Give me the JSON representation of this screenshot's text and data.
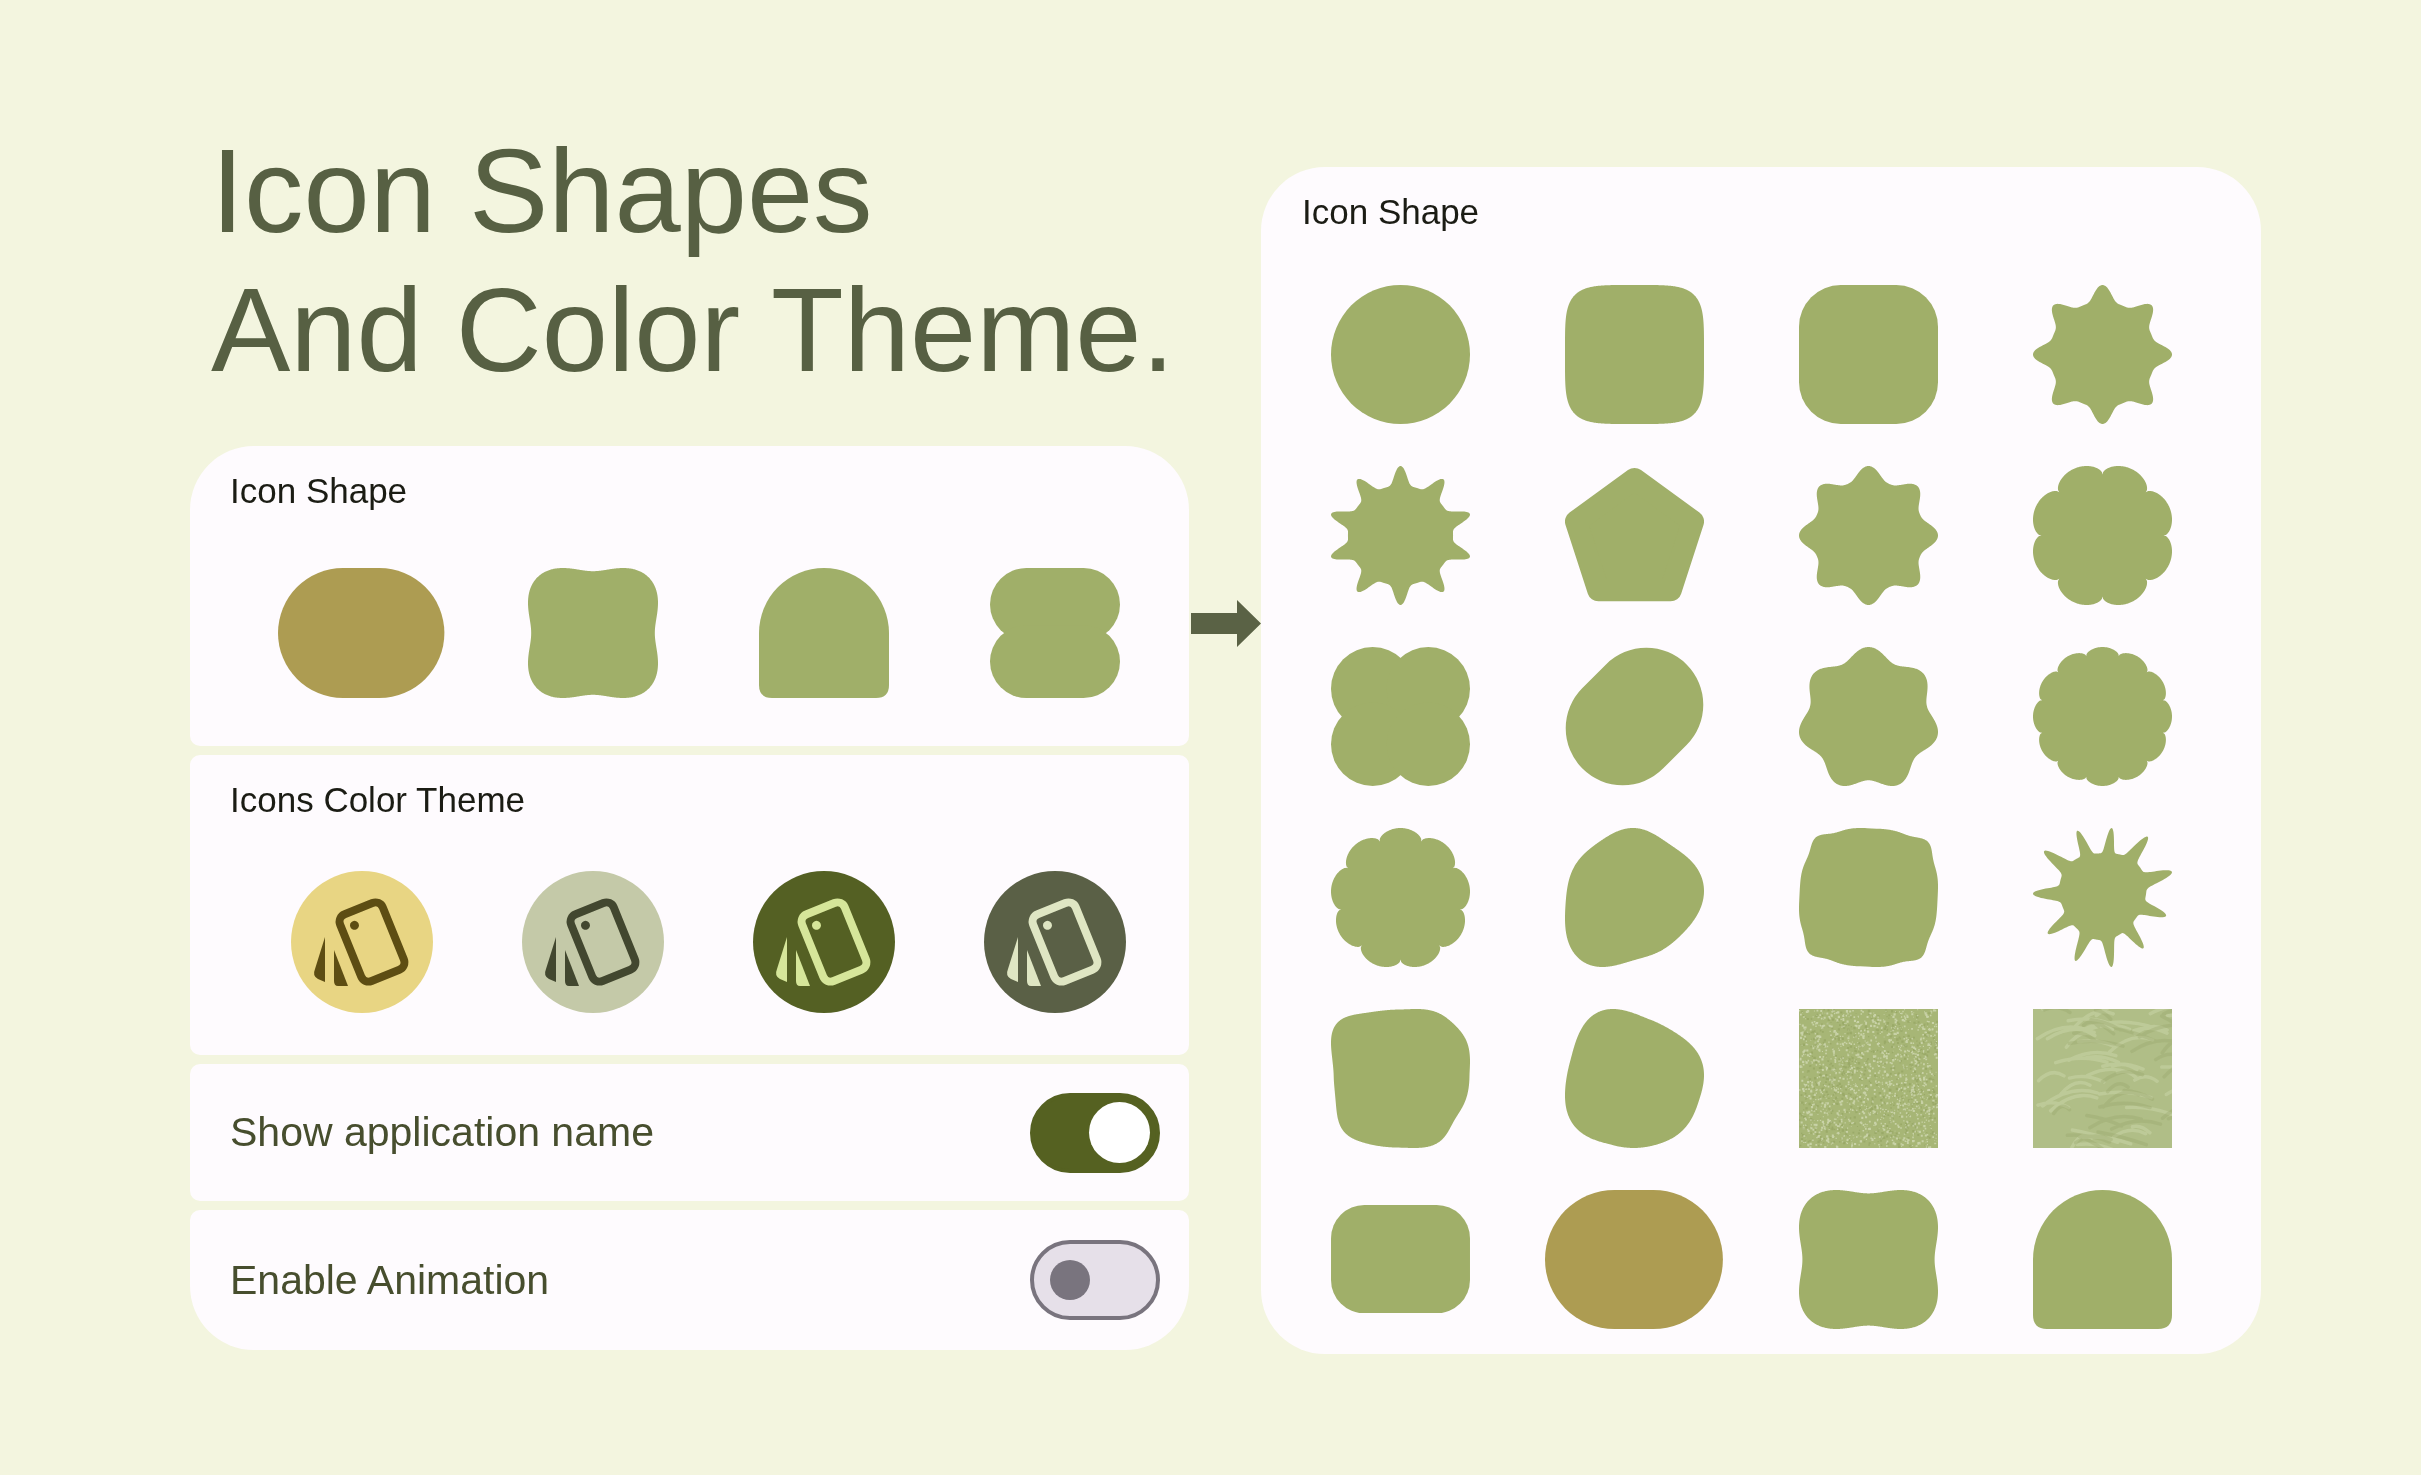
{
  "headline": {
    "lines": [
      "Icon Shapes",
      "And Color Theme."
    ]
  },
  "settings": {
    "shape_picker": {
      "title": "Icon Shape",
      "shapes": [
        {
          "kind": "pill",
          "color": "#ad9c52"
        },
        {
          "kind": "soft-clover",
          "color": "#a0af69"
        },
        {
          "kind": "arch",
          "color": "#a0af69"
        },
        {
          "kind": "stacked-pills",
          "color": "#a0af69"
        }
      ]
    },
    "color_theme": {
      "title": "Icons Color Theme",
      "themes": [
        {
          "color": "#e8d583",
          "icon": {
            "color": "#5d4d13"
          }
        },
        {
          "color": "#c4c9a8",
          "icon": {
            "color": "#42472f"
          }
        },
        {
          "color": "#546023",
          "icon": {
            "color": "#d6e69a"
          }
        },
        {
          "color": "#5a6046",
          "icon": {
            "color": "#dfe6c3"
          }
        }
      ]
    },
    "toggles": [
      {
        "label": "Show application name",
        "on": true
      },
      {
        "label": "Enable Animation",
        "on": false
      }
    ]
  },
  "shape_gallery": {
    "title": "Icon Shape",
    "shapes": [
      {
        "kind": "circle",
        "color": "#a0af69"
      },
      {
        "kind": "squircle",
        "color": "#a0af69"
      },
      {
        "kind": "rounded-square",
        "color": "#a0af69"
      },
      {
        "kind": "soft-star",
        "color": "#a0af69"
      },
      {
        "kind": "burst",
        "color": "#a0af69"
      },
      {
        "kind": "pentagon",
        "color": "#a0af69"
      },
      {
        "kind": "cookie-star",
        "color": "#a0af69"
      },
      {
        "kind": "flower",
        "color": "#a0af69"
      },
      {
        "kind": "four-circle-clover",
        "color": "#a0af69"
      },
      {
        "kind": "slanted-pill",
        "color": "#a0af69"
      },
      {
        "kind": "wavy",
        "color": "#a0af69"
      },
      {
        "kind": "scallop-12",
        "color": "#a0af69"
      },
      {
        "kind": "scallop-9",
        "color": "#a0af69"
      },
      {
        "kind": "blob",
        "color": "#a0af69"
      },
      {
        "kind": "puffy-square",
        "color": "#a0af69"
      },
      {
        "kind": "spiky-burst",
        "color": "#a0af69"
      },
      {
        "kind": "blob-square",
        "color": "#a0af69"
      },
      {
        "kind": "tilted-blob",
        "color": "#a0af69"
      },
      {
        "kind": "grain-texture",
        "color": "#a7b676"
      },
      {
        "kind": "soft-texture",
        "color": "#b0be87"
      },
      {
        "kind": "rounded-rect",
        "color": "#a0af69"
      },
      {
        "kind": "pill",
        "color": "#ad9c52"
      },
      {
        "kind": "soft-clover",
        "color": "#a0af69"
      },
      {
        "kind": "arch",
        "color": "#a0af69"
      }
    ]
  }
}
